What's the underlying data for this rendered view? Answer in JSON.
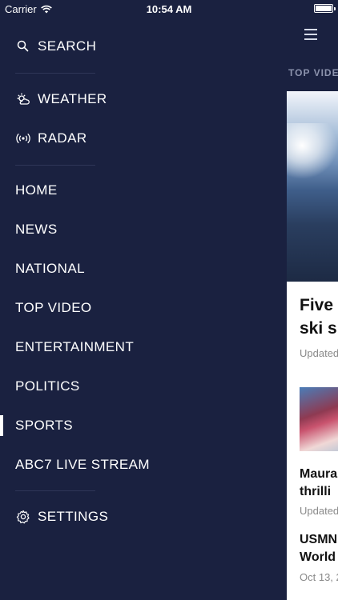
{
  "status_bar": {
    "carrier": "Carrier",
    "time": "10:54 AM"
  },
  "menu": {
    "items": [
      {
        "label": "SEARCH",
        "icon": "search-icon"
      },
      {
        "label": "WEATHER",
        "icon": "weather-icon"
      },
      {
        "label": "RADAR",
        "icon": "radar-icon"
      },
      {
        "label": "HOME"
      },
      {
        "label": "NEWS"
      },
      {
        "label": "NATIONAL"
      },
      {
        "label": "TOP VIDEO"
      },
      {
        "label": "ENTERTAINMENT"
      },
      {
        "label": "POLITICS"
      },
      {
        "label": "SPORTS",
        "active": true
      },
      {
        "label": "ABC7 LIVE STREAM"
      },
      {
        "label": "SETTINGS",
        "icon": "gear-icon"
      }
    ]
  },
  "content": {
    "tab_label": "TOP VIDE",
    "article1": {
      "headline_line1": "Five",
      "headline_line2": "ski s",
      "meta": "Updated"
    },
    "article2": {
      "headline_line1": "Maura",
      "headline_line2": "thrilli",
      "meta": "Updated"
    },
    "article3": {
      "headline_line1": "USMN",
      "headline_line2": "World",
      "meta": "Oct 13, 2"
    }
  },
  "colors": {
    "menu_bg": "#1a2140",
    "text": "#ffffff",
    "divider": "#2e3657"
  }
}
